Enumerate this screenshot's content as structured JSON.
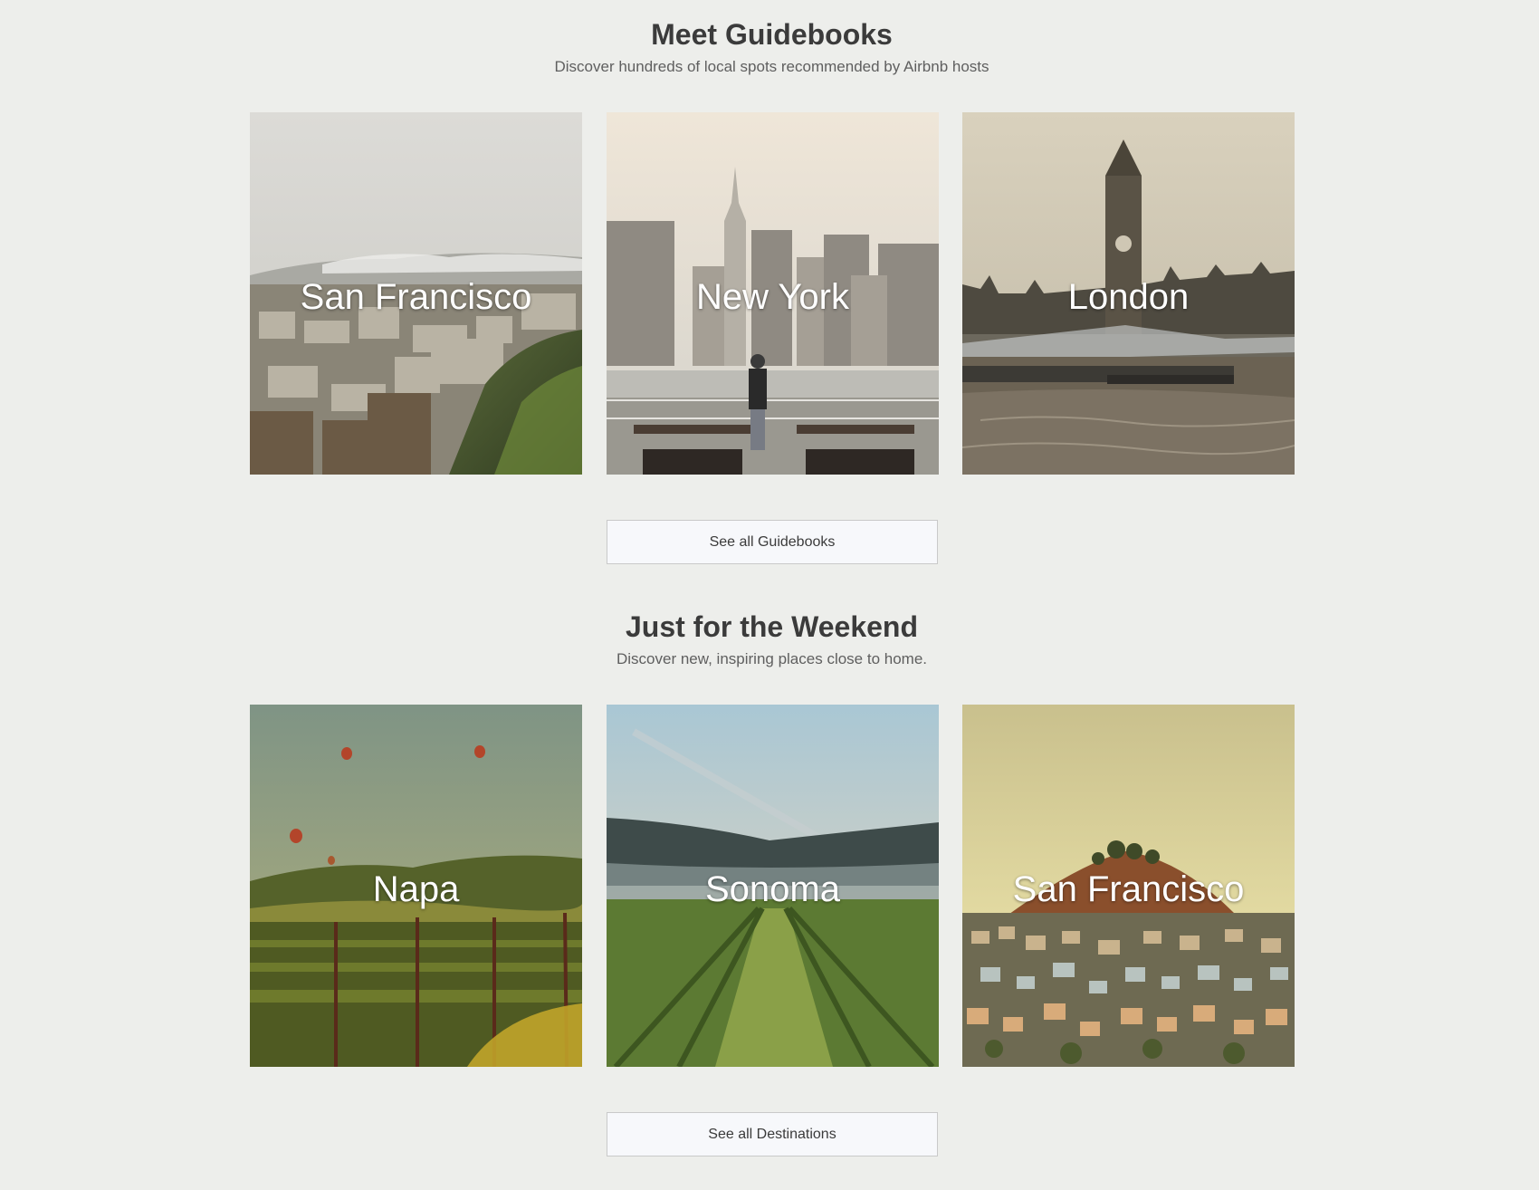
{
  "guidebooks": {
    "title": "Meet Guidebooks",
    "subtitle": "Discover hundreds of local spots recommended by Airbnb hosts",
    "cards": [
      {
        "label": "San Francisco",
        "image": "san-francisco-city-hillside-photo"
      },
      {
        "label": "New York",
        "image": "new-york-skyline-waterfront-photo"
      },
      {
        "label": "London",
        "image": "london-big-ben-thames-photo"
      }
    ],
    "button_label": "See all Guidebooks"
  },
  "weekend": {
    "title": "Just for the Weekend",
    "subtitle": "Discover new, inspiring places close to home.",
    "cards": [
      {
        "label": "Napa",
        "image": "napa-vineyard-balloons-photo"
      },
      {
        "label": "Sonoma",
        "image": "sonoma-vineyard-rows-photo"
      },
      {
        "label": "San Francisco",
        "image": "san-francisco-hill-houses-photo"
      }
    ],
    "button_label": "See all Destinations"
  },
  "colors": {
    "background": "#edeeeb",
    "heading": "#3b3b3b",
    "subtitle": "#5f5f5f",
    "button_bg": "#f7f8fb",
    "button_border": "#c9c9c9"
  }
}
